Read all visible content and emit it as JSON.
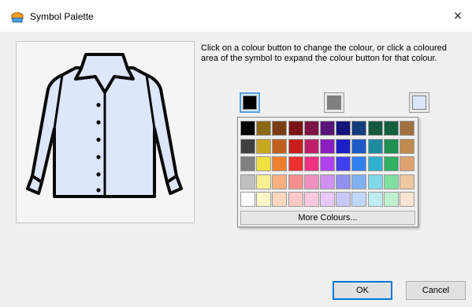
{
  "window": {
    "title": "Symbol Palette",
    "close_label": "×"
  },
  "instructions": "Click on a colour button to change the colour, or click a coloured area of the symbol to expand the colour button for that colour.",
  "symbol": {
    "icon": "shirt-icon",
    "fill": "#dde6fb",
    "stroke": "#0a0a0a"
  },
  "colour_buttons": [
    {
      "name": "black",
      "color": "#000000",
      "active": true
    },
    {
      "name": "grey",
      "color": "#808080",
      "active": false
    },
    {
      "name": "light-blue",
      "color": "#dde6fb",
      "active": false
    }
  ],
  "palette": {
    "selected": [
      0,
      0
    ],
    "rows": [
      [
        "#000000",
        "#8b6a13",
        "#7b3c13",
        "#7b1313",
        "#7b1343",
        "#5a137b",
        "#13137b",
        "#133c7b",
        "#135a3c",
        "#13603c",
        "#a07040"
      ],
      [
        "#404040",
        "#c8a81e",
        "#c0601e",
        "#c81e1e",
        "#c01e6a",
        "#8a1ec0",
        "#1e1ec8",
        "#1e5ac8",
        "#1e8aa0",
        "#1e9050",
        "#c08a50"
      ],
      [
        "#808080",
        "#f0e040",
        "#f08030",
        "#f03030",
        "#f03080",
        "#b040f0",
        "#4040f0",
        "#3080f0",
        "#30b0d0",
        "#30b060",
        "#e0a070"
      ],
      [
        "#c0c0c0",
        "#f8f090",
        "#f8b080",
        "#f89090",
        "#f090c0",
        "#d090f0",
        "#9090f0",
        "#80b0f0",
        "#80d8e8",
        "#80e0a0",
        "#f0c8a0"
      ],
      [
        "#ffffff",
        "#fcf8c8",
        "#fcd8c0",
        "#fcc8c8",
        "#f8c8e0",
        "#e8c8f8",
        "#c8c8f8",
        "#c0d8f8",
        "#c0ecf4",
        "#c0f0d0",
        "#f8e4d0"
      ]
    ],
    "more_label": "More Colours..."
  },
  "buttons": {
    "ok": "OK",
    "cancel": "Cancel"
  }
}
